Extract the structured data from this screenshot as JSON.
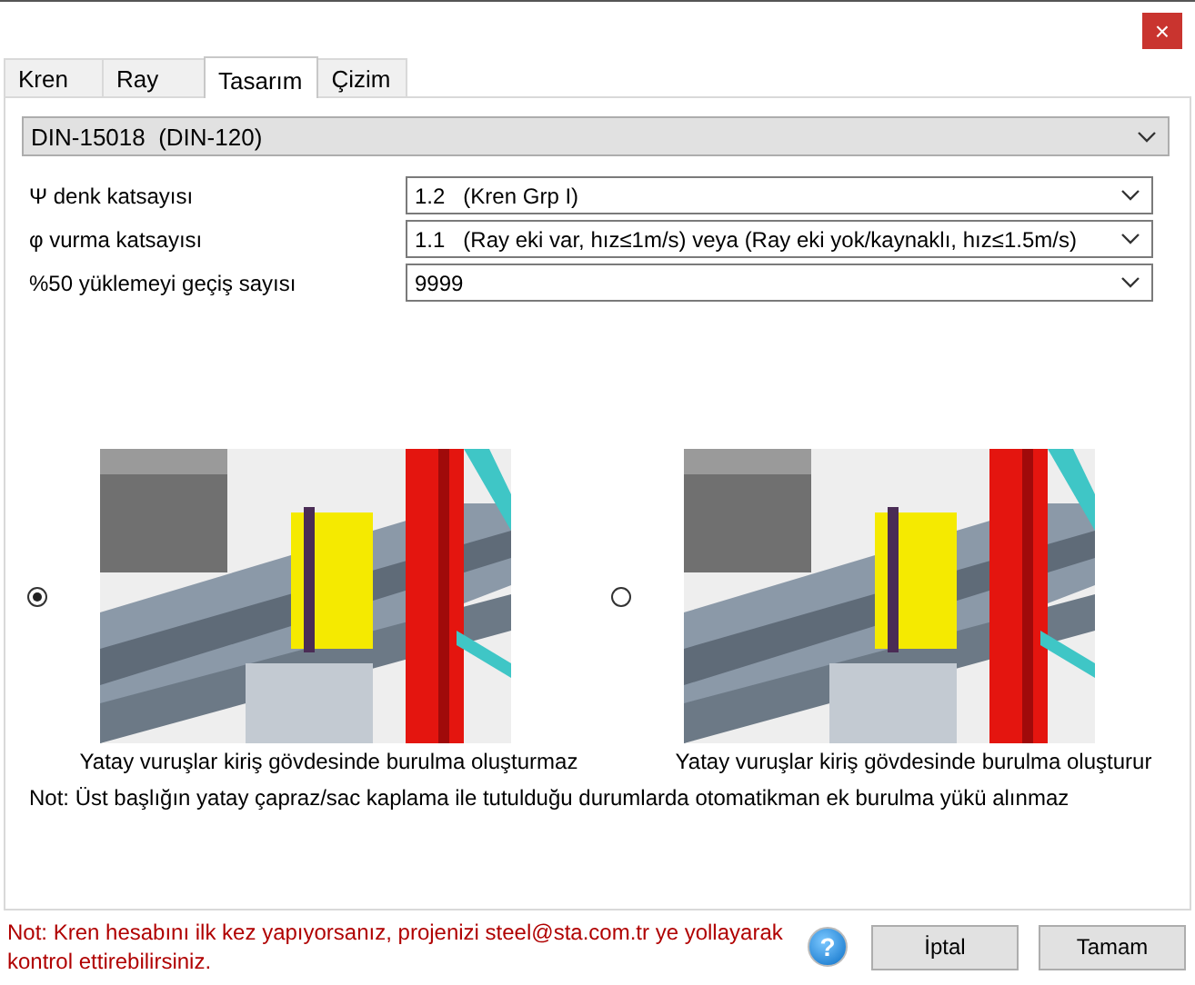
{
  "window": {
    "close": "×"
  },
  "tabs": [
    {
      "label": "Kren",
      "selected": false
    },
    {
      "label": "Ray",
      "selected": false
    },
    {
      "label": "Tasarım",
      "selected": true
    },
    {
      "label": "Çizim",
      "selected": false
    }
  ],
  "standard": {
    "value": "DIN-15018  (DIN-120)"
  },
  "fields": [
    {
      "label": "Ψ denk katsayısı",
      "value": "1.2   (Kren Grp I)"
    },
    {
      "label": "φ vurma katsayısı",
      "value": "1.1   (Ray eki var, hız≤1m/s) veya (Ray eki yok/kaynaklı, hız≤1.5m/s)"
    },
    {
      "label": "%50 yüklemeyi geçiş sayısı",
      "value": "9999"
    }
  ],
  "options": [
    {
      "caption": "Yatay vuruşlar kiriş gövdesinde burulma oluşturmaz",
      "selected": true,
      "kind": "picture"
    },
    {
      "caption": "Yatay vuruşlar kiriş gövdesinde burulma oluşturur",
      "selected": false,
      "kind": "picture"
    }
  ],
  "note": "Not: Üst başlığın yatay çapraz/sac kaplama ile tutulduğu durumlarda otomatikman ek burulma yükü alınmaz",
  "footer_note": "Not: Kren hesabını ilk kez yapıyorsanız, projenizi steel@sta.com.tr ye yollayarak kontrol ettirebilirsiniz.",
  "help": "?",
  "buttons": [
    "İptal",
    "Tamam"
  ]
}
